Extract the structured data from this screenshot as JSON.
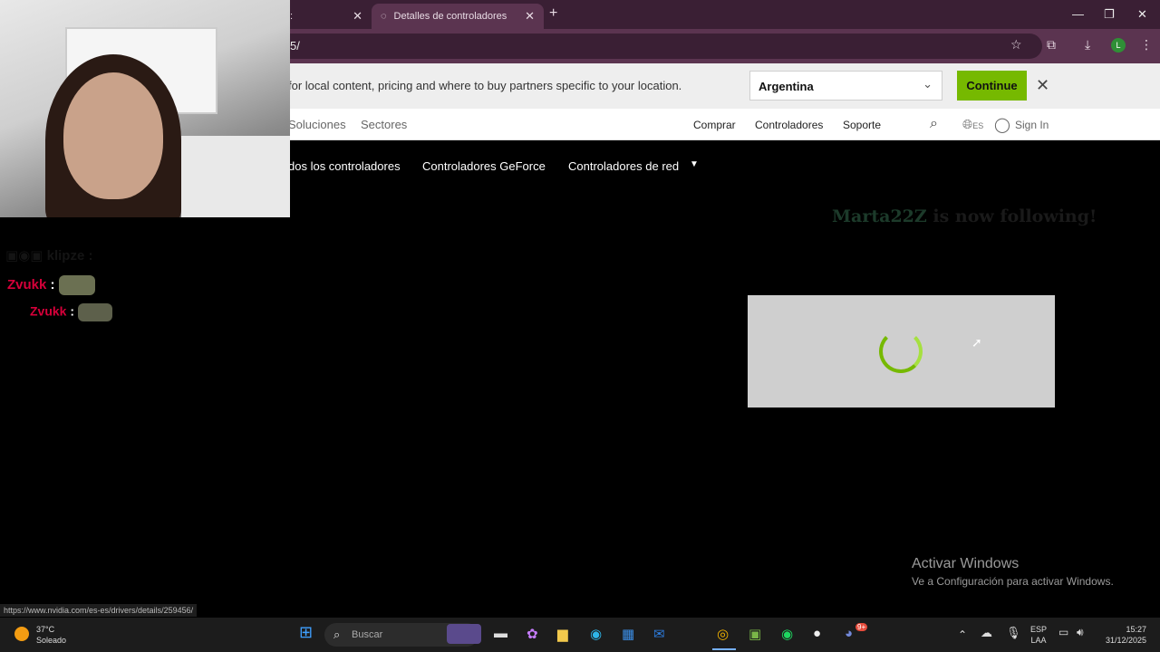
{
  "browser": {
    "tabs": [
      {
        "label": ":"
      },
      {
        "label": "Detalles de controladores",
        "active": true
      }
    ],
    "address": "5/",
    "profile_initial": "L"
  },
  "location_bar": {
    "message": "for local content, pricing and where to buy partners specific to your location.",
    "country": "Argentina",
    "continue_label": "Continue"
  },
  "nav": {
    "left_items": [
      "Soluciones",
      "Sectores"
    ],
    "right_items": [
      "Comprar",
      "Controladores",
      "Soporte"
    ],
    "lang": "ES",
    "signin": "Sign In"
  },
  "subnav": {
    "items": [
      "dos los controladores",
      "Controladores GeForce",
      "Controladores de red"
    ]
  },
  "chat": {
    "lines": [
      {
        "user": "klipze",
        "sep": ":"
      },
      {
        "user": "Zvukk",
        "sep": ":"
      },
      {
        "user": "Zvukk",
        "sep": ":"
      }
    ],
    "follow_user": "Marta22Z",
    "follow_text": "is now following!"
  },
  "overlay": {
    "activate_title": "Activar Windows",
    "activate_sub": "Ve a Configuración para activar Windows.",
    "status_url": "https://www.nvidia.com/es-es/drivers/details/259456/"
  },
  "taskbar": {
    "weather_temp": "37°C",
    "weather_desc": "Soleado",
    "search_placeholder": "Buscar",
    "lang_line1": "ESP",
    "lang_line2": "LAA",
    "time": "15:27",
    "date": "31/12/2025",
    "discord_badge": "9+"
  },
  "colors": {
    "accent": "#76b900",
    "chrome": "#3a1f34",
    "chat_user": "#d6003a"
  }
}
